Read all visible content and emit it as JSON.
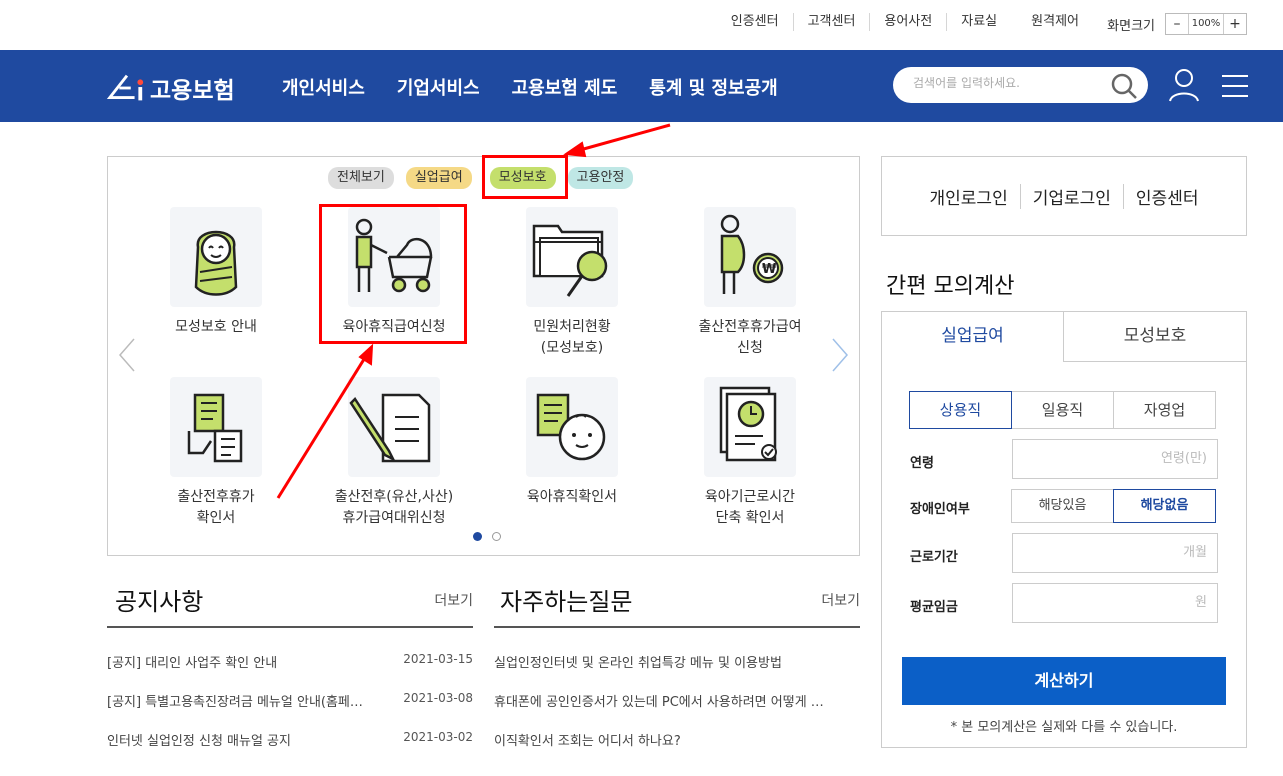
{
  "util": {
    "links": [
      "인증센터",
      "고객센터",
      "용어사전",
      "자료실"
    ],
    "remote": "원격제어",
    "zoom_label": "화면크기",
    "zoom_minus": "–",
    "zoom_value": "100%",
    "zoom_plus": "+"
  },
  "nav": {
    "logo": "고용보험",
    "menu": [
      "개인서비스",
      "기업서비스",
      "고용보험 제도",
      "통계 및 정보공개"
    ],
    "search_placeholder": "검색어를 입력하세요."
  },
  "panel": {
    "tags": [
      "전체보기",
      "실업급여",
      "모성보호",
      "고용안정"
    ],
    "cards": [
      {
        "label": "모성보호 안내"
      },
      {
        "label": "육아휴직급여신청"
      },
      {
        "label": "민원처리현황\n(모성보호)"
      },
      {
        "label": "출산전후휴가급여\n신청"
      },
      {
        "label": "출산전후휴가\n확인서"
      },
      {
        "label": "출산전후(유산,사산)\n휴가급여대위신청"
      },
      {
        "label": "육아휴직확인서"
      },
      {
        "label": "육아기근로시간\n단축 확인서"
      }
    ]
  },
  "notice": {
    "title": "공지사항",
    "more": "더보기",
    "items": [
      {
        "text": "[공지] 대리인 사업주 확인 안내",
        "date": "2021-03-15"
      },
      {
        "text": "[공지] 특별고용촉진장려금 메뉴얼 안내(홈페…",
        "date": "2021-03-08"
      },
      {
        "text": "인터넷 실업인정 신청 매뉴얼 공지",
        "date": "2021-03-02"
      }
    ]
  },
  "faq": {
    "title": "자주하는질문",
    "more": "더보기",
    "items": [
      {
        "text": "실업인정인터넷 및 온라인 취업특강 메뉴 및 이용방법"
      },
      {
        "text": "휴대폰에 공인인증서가 있는데 PC에서 사용하려면 어떻게 …"
      },
      {
        "text": "이직확인서 조회는 어디서 하나요?"
      }
    ]
  },
  "login": [
    "개인로그인",
    "기업로그인",
    "인증센터"
  ],
  "calc": {
    "title": "간편 모의계산",
    "tabs": [
      "실업급여",
      "모성보호"
    ],
    "types": [
      "상용직",
      "일용직",
      "자영업"
    ],
    "age_label": "연령",
    "age_placeholder": "연령(만)",
    "disability_label": "장애인여부",
    "disability_options": [
      "해당있음",
      "해당없음"
    ],
    "period_label": "근로기간",
    "period_placeholder": "개월",
    "wage_label": "평균임금",
    "wage_placeholder": "원",
    "button": "계산하기",
    "note": "* 본 모의계산은 실제와 다를 수 있습니다."
  },
  "colors": {
    "nav_bg": "#1f4aa0",
    "accent": "#0b5fc7",
    "annotation": "#ff0000",
    "tag_unemployment": "#f5d986",
    "tag_maternity": "#c4df6c",
    "tag_employment": "#bfe7e5",
    "icon_green": "#c4df6c"
  }
}
